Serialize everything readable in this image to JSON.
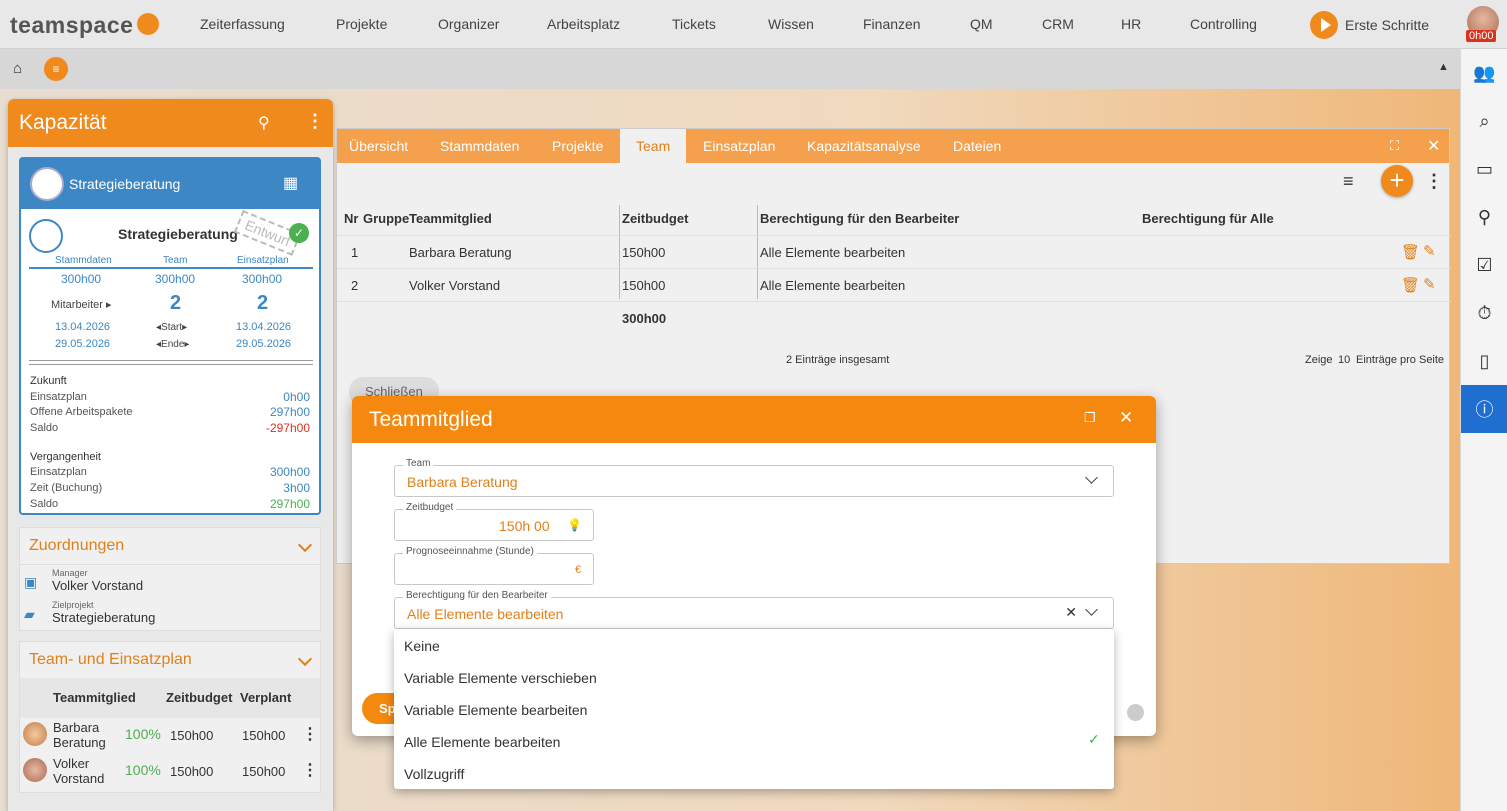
{
  "app": {
    "logo": "teamspace"
  },
  "nav": {
    "items": [
      "Zeiterfassung",
      "Projekte",
      "Organizer",
      "Arbeitsplatz",
      "Tickets",
      "Wissen",
      "Finanzen",
      "QM",
      "CRM",
      "HR",
      "Controlling"
    ],
    "erste": "Erste Schritte",
    "timer": "0h00"
  },
  "kapazitaet": {
    "title": "Kapazität",
    "card": {
      "name": "Strategieberatung",
      "stamp": "Entwurf",
      "cols": [
        "Stammdaten",
        "Team",
        "Einsatzplan"
      ],
      "hours": [
        "300h00",
        "300h00",
        "300h00"
      ],
      "mitarbeiter_label": "Mitarbeiter ▸",
      "mitarbeiter": [
        "2",
        "2"
      ],
      "start": [
        "13.04.2026",
        "◂Start▸",
        "13.04.2026"
      ],
      "ende": [
        "29.05.2026",
        "◂Ende▸",
        "29.05.2026"
      ],
      "zukunft": "Zukunft",
      "zk_rows": [
        [
          "Einsatzplan",
          "0h00"
        ],
        [
          "Offene Arbeitspakete",
          "297h00"
        ],
        [
          "Saldo",
          "-297h00"
        ]
      ],
      "vergangenheit": "Vergangenheit",
      "vg_rows": [
        [
          "Einsatzplan",
          "300h00"
        ],
        [
          "Zeit (Buchung)",
          "3h00"
        ],
        [
          "Saldo",
          "297h00"
        ]
      ]
    },
    "zuordnungen": {
      "title": "Zuordnungen",
      "manager_lbl": "Manager",
      "manager": "Volker Vorstand",
      "ziel_lbl": "Zielprojekt",
      "ziel": "Strategieberatung"
    },
    "team": {
      "title": "Team- und Einsatzplan",
      "headers": [
        "Teammitglied",
        "Zeitbudget",
        "Verplant"
      ],
      "rows": [
        {
          "name1": "Barbara",
          "name2": "Beratung",
          "pct": "100%",
          "budget": "150h00",
          "verplant": "150h00"
        },
        {
          "name1": "Volker",
          "name2": "Vorstand",
          "pct": "100%",
          "budget": "150h00",
          "verplant": "150h00"
        }
      ]
    }
  },
  "main": {
    "tabs": [
      "Übersicht",
      "Stammdaten",
      "Projekte",
      "Team",
      "Einsatzplan",
      "Kapazitätsanalyse",
      "Dateien"
    ],
    "headers": [
      "Nr",
      "Gruppe",
      "Teammitglied",
      "Zeitbudget",
      "Berechtigung für den Bearbeiter",
      "Berechtigung für Alle"
    ],
    "rows": [
      {
        "nr": "1",
        "name": "Barbara Beratung",
        "budget": "150h00",
        "perm": "Alle Elemente bearbeiten"
      },
      {
        "nr": "2",
        "name": "Volker Vorstand",
        "budget": "150h00",
        "perm": "Alle Elemente bearbeiten"
      }
    ],
    "total": "300h00",
    "footer": "2 Einträge insgesamt",
    "zeige": "Zeige",
    "pagesize": "10",
    "pro_seite": "Einträge pro Seite",
    "close": "Schließen"
  },
  "dialog": {
    "title": "Teammitglied",
    "team_lbl": "Team",
    "team_val": "Barbara Beratung",
    "zeit_lbl": "Zeitbudget",
    "zeit_val": "150h 00",
    "prog_lbl": "Prognoseeinnahme (Stunde)",
    "prog_cur": "€",
    "perm_lbl": "Berechtigung für den Bearbeiter",
    "perm_val": "Alle Elemente bearbeiten",
    "save": "Sp",
    "options": [
      "Keine",
      "Variable Elemente verschieben",
      "Variable Elemente bearbeiten",
      "Alle Elemente bearbeiten",
      "Vollzugriff"
    ],
    "selected": 3
  }
}
